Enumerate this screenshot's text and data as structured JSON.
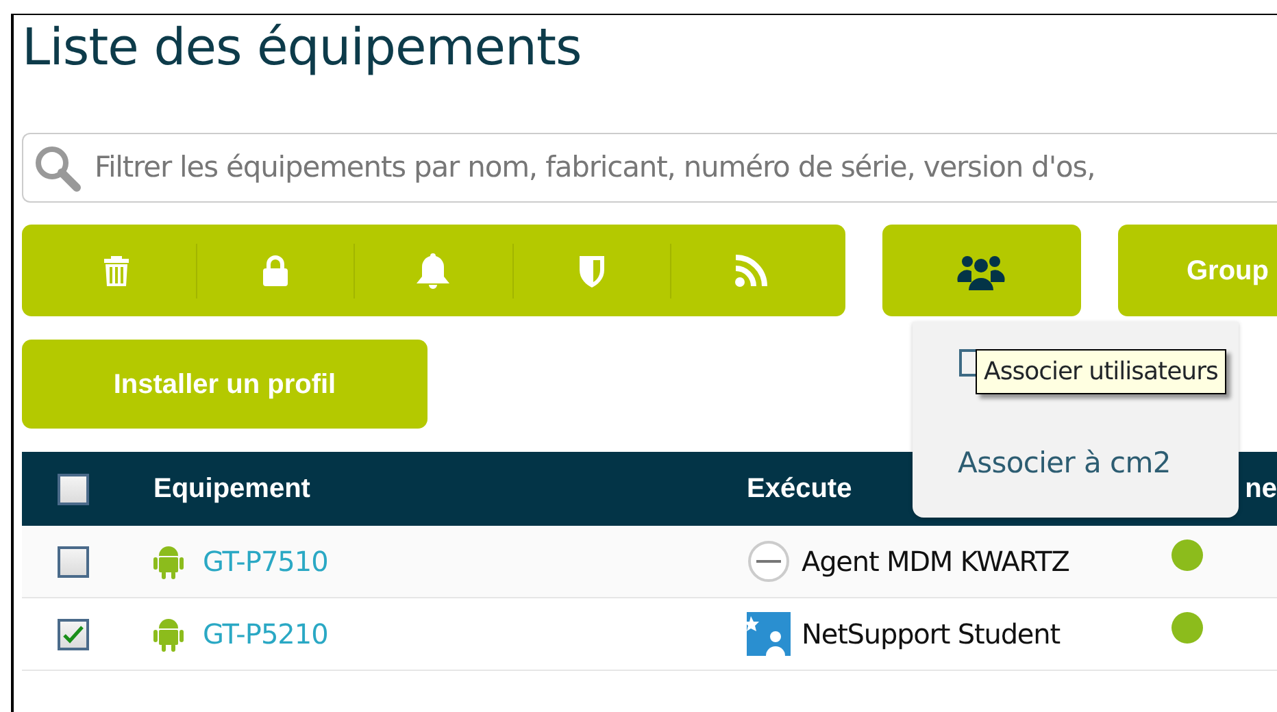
{
  "title": "Liste des équipements",
  "search": {
    "placeholder": "Filtrer les équipements par nom, fabricant, numéro de série, version d'os,"
  },
  "action_group": [
    {
      "kind": "trash"
    },
    {
      "kind": "lock"
    },
    {
      "kind": "bell"
    },
    {
      "kind": "shield"
    },
    {
      "kind": "feed"
    }
  ],
  "users_button": {
    "kind": "users",
    "expanded": true
  },
  "group_button": {
    "label": "Group"
  },
  "install_button": {
    "label": "Installer un profil"
  },
  "dropdown": {
    "items": [
      {
        "kind": "checkbox",
        "checked": false
      },
      {
        "kind": "link",
        "label": "Associer à cm2"
      }
    ]
  },
  "tooltip": {
    "text": "Associer utilisateurs"
  },
  "table": {
    "select_all": {
      "checked": false
    },
    "columns": [
      "Equipement",
      "Exécute",
      "ne"
    ],
    "rows": [
      {
        "checked": false,
        "device": "GT-P7510",
        "kind": "round",
        "app": "Agent MDM KWARTZ",
        "color": "#8cbc1c"
      },
      {
        "checked": true,
        "device": "GT-P5210",
        "kind": "square",
        "app": "NetSupport Student",
        "color": "#8cbc1c"
      }
    ]
  }
}
